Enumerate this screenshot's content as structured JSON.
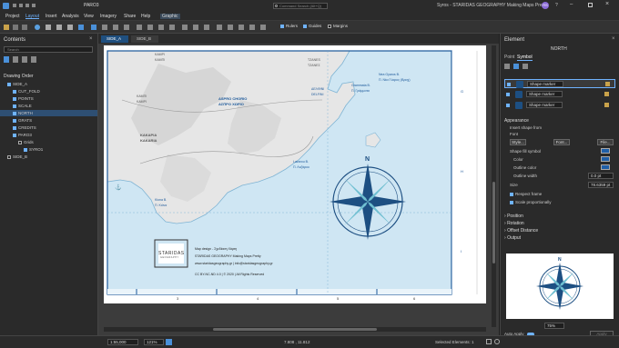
{
  "titlebar": {
    "search_placeholder": "Command Search (Alt+Q)",
    "window_title": "Syros - STARIDAS GEOGRAPHY Making Maps Pretty",
    "layout_selector": "PARO3",
    "user_initials": "RS"
  },
  "menu": {
    "items": [
      "Project",
      "Layout",
      "Insert",
      "Analysis",
      "View",
      "Imagery",
      "Share",
      "Help"
    ],
    "active": "Layout",
    "contextual": "Graphic"
  },
  "ribbon": {
    "rulers_label": "Rulers",
    "guides_label": "Guides",
    "margins_label": "Margins"
  },
  "contents": {
    "title": "Contents",
    "search_placeholder": "Search",
    "drawing_order_label": "Drawing Order",
    "layers": [
      {
        "label": "SIDE_A",
        "level": 0,
        "checked": true,
        "selected": false
      },
      {
        "label": "CUT_FOLD",
        "level": 1,
        "checked": true,
        "selected": false
      },
      {
        "label": "POINTS",
        "level": 1,
        "checked": true,
        "selected": false
      },
      {
        "label": "SCALE",
        "level": 1,
        "checked": true,
        "selected": false
      },
      {
        "label": "NORTH",
        "level": 1,
        "checked": true,
        "selected": true
      },
      {
        "label": "GRATS",
        "level": 1,
        "checked": true,
        "selected": false
      },
      {
        "label": "CREDITS",
        "level": 1,
        "checked": true,
        "selected": false
      },
      {
        "label": "PARO3",
        "level": 1,
        "checked": true,
        "selected": false
      },
      {
        "label": "Grids",
        "level": 2,
        "checked": false,
        "selected": false
      },
      {
        "label": "SYRO1",
        "level": 3,
        "checked": true,
        "selected": false
      },
      {
        "label": "SIDE_B",
        "level": 0,
        "checked": false,
        "selected": false
      }
    ]
  },
  "view_tabs": [
    "SIDE_A",
    "SIDE_B"
  ],
  "map": {
    "labels": {
      "kampi": "ΚΑΜΠΙ",
      "kampi_latin": "KAMPI",
      "kampi_greek": "ΚΑΜΠΙ",
      "kampi2": "KAMPI",
      "kambos": "ΚΑΜΠΟΣ",
      "tzanes": "ΤΖΑΝΕΣ",
      "tzanes_latin": "TZANES",
      "aspro_chorio": "ΑΣΠΡΟ ΧΩΡΙΟ",
      "aspro_chorio_latin": "ASPRO CHORIO",
      "delfini": "ΔΕΛΦΙΝΙ",
      "delfini_latin": "DELFINI",
      "kakaria": "ΚΑΚΑΡΙΑ",
      "kakaria_latin": "KAKARIA",
      "nea_gyaros": "Nea Gyaros B.",
      "nea_gyaros_greek": "Π. Νέα Γύαρος (Βραχ)",
      "grammata": "Grammata B.",
      "grammata_greek": "Π. Γράμματα",
      "varvarousa": "Varvarousa B.",
      "varvarousa_greek": "Π. Βαρβαρούσα",
      "lazarou": "Lazarou B.",
      "lazarou_greek": "Π. Λαζάρου",
      "kiona": "Kiona B.",
      "kiona_greek": "Π. Κιόνα"
    },
    "grid_numbers": [
      "3",
      "4",
      "5",
      "6"
    ],
    "grid_letters": [
      "G",
      "H",
      "I"
    ],
    "credits": {
      "logo_text": "STARIDAS",
      "logo_sub": "GEOGRAPHY",
      "line1": "Map design - Σχεδίαση Χάρτη",
      "line2": "STARIDAS GEOGRAPHY Making Maps Pretty",
      "line3": "www.staridasgeography.gr | info@staridasgeography.gr",
      "line4": "CC BY-NC-ND 4.0 | © 2020 | All Rights Reserved"
    }
  },
  "element": {
    "title": "Element",
    "subtitle": "NORTH",
    "tabs": [
      "Point",
      "Symbol"
    ],
    "active_tab": "Symbol",
    "layers": [
      {
        "label": "Shape marker",
        "selected": true
      },
      {
        "label": "Shape marker",
        "selected": false
      },
      {
        "label": "Shape marker",
        "selected": false
      }
    ],
    "appearance_title": "Appearance",
    "insert_shape_from": "Insert shape from",
    "font_label": "Font",
    "style_button": "Style...",
    "font_button": "Font...",
    "file_button": "File...",
    "shape_fill_label": "Shape fill symbol",
    "color_label": "Color",
    "outline_color_label": "Outline color",
    "outline_width_label": "Outline width",
    "outline_width_value": "0.0 pt",
    "size_label": "Size",
    "size_value": "78.6359 pt",
    "respect_frame": "Respect frame",
    "scale_proportionally": "Scale proportionally",
    "collapsed_sections": [
      "Position",
      "Rotation",
      "Offset Distance",
      "Output"
    ],
    "preview_zoom": "75%",
    "auto_apply": "Auto Apply",
    "fill_color": "#1f5fa8",
    "outline_color": "#1f5fa8"
  },
  "status": {
    "scale": "1:55,000",
    "zoom": "121%",
    "coords": "7.808 , 11.812",
    "selected": "Selected Elements: 1"
  },
  "colors": {
    "accent": "#6fb3ff",
    "sea": "#cfe6f3",
    "land": "#e6e6e6",
    "compass_dark": "#1d4f82",
    "compass_light": "#6fbfd1",
    "frame": "#1a5799"
  }
}
